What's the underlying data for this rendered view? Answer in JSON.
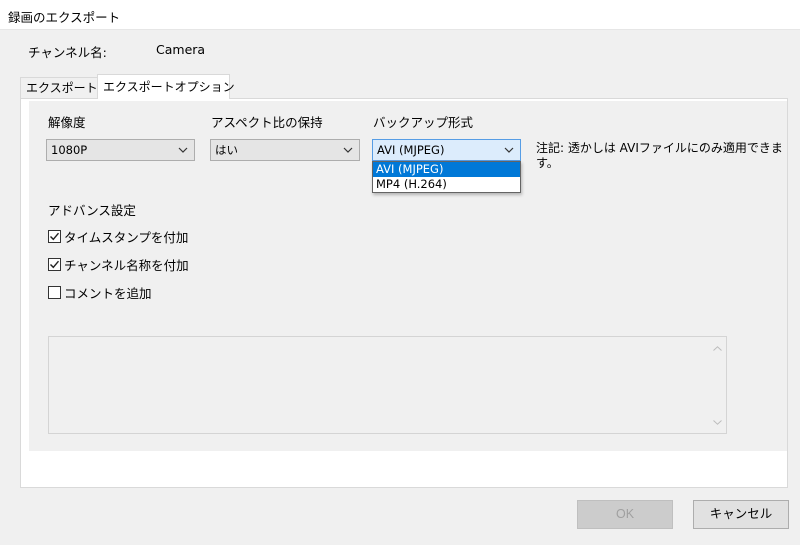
{
  "window": {
    "title": "録画のエクスポート"
  },
  "channel": {
    "label": "チャンネル名:",
    "value": "Camera"
  },
  "tabs": [
    {
      "label": "エクスポート",
      "active": false
    },
    {
      "label": "エクスポートオプション",
      "active": true
    }
  ],
  "options": {
    "resolution": {
      "label": "解像度",
      "value": "1080P"
    },
    "aspect": {
      "label": "アスペクト比の保持",
      "value": "はい"
    },
    "backup": {
      "label": "バックアップ形式",
      "value": "AVI (MJPEG)",
      "options": [
        "AVI (MJPEG)",
        "MP4 (H.264)"
      ],
      "selected_index": 0
    },
    "note_line1": "注記: 透かしは AVIファイルにのみ適用できま",
    "note_line2": "す。"
  },
  "advanced": {
    "heading": "アドバンス設定",
    "checkboxes": [
      {
        "label": "タイムスタンプを付加",
        "checked": true
      },
      {
        "label": "チャンネル名称を付加",
        "checked": true
      },
      {
        "label": "コメントを追加",
        "checked": false
      }
    ],
    "comment": ""
  },
  "buttons": {
    "ok": "OK",
    "cancel": "キャンセル"
  },
  "colors": {
    "selection": "#0078d7",
    "focus_border": "#569de5"
  }
}
